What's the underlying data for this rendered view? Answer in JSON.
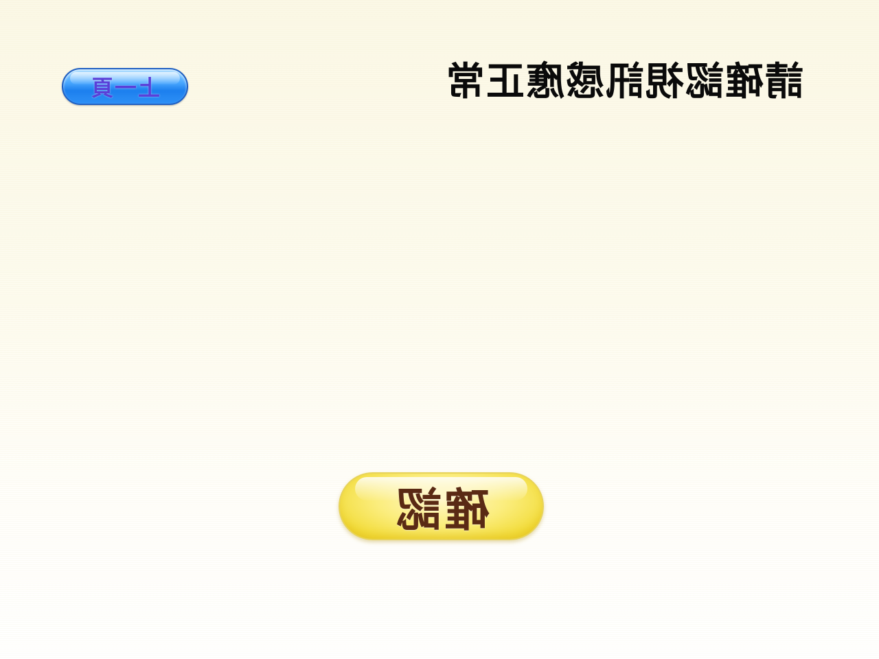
{
  "header": {
    "prev_label": "上一頁",
    "title": "請確認視訊感應正常"
  },
  "footer": {
    "confirm_label": "確認"
  },
  "colors": {
    "prev_button": "#2d90f6",
    "prev_label": "#5a3fd8",
    "confirm_button": "#f2dc3a",
    "confirm_label": "#5a2a14",
    "title": "#0a0a0a"
  }
}
